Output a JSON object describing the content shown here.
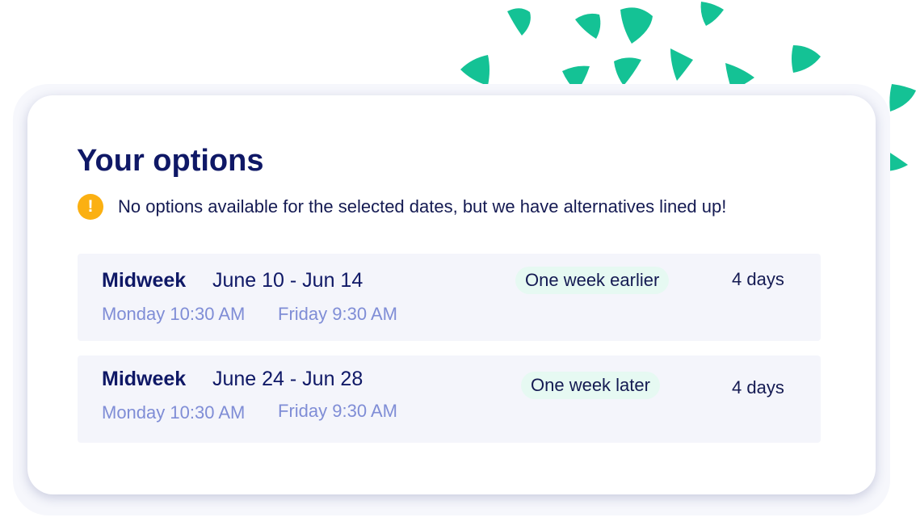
{
  "title": "Your options",
  "notice": {
    "icon": "warning-icon",
    "icon_glyph": "!",
    "text": "No options available for the selected dates, but we have alternatives lined up!"
  },
  "options": [
    {
      "kind": "Midweek",
      "range": "June 10 - Jun 14",
      "check_in": "Monday 10:30 AM",
      "check_out": "Friday 9:30 AM",
      "tag": "One week earlier",
      "duration": "4 days"
    },
    {
      "kind": "Midweek",
      "range": "June 24 - Jun 28",
      "check_in": "Monday 10:30 AM",
      "check_out": "Friday 9:30 AM",
      "tag": "One week later",
      "duration": "4 days"
    }
  ],
  "colors": {
    "heading": "#0f1866",
    "text": "#141a52",
    "muted_time": "#7f8dd6",
    "warning": "#fbb012",
    "tag_background": "#e6f9f2",
    "row_background": "#f4f5fb",
    "confetti": "#14c295"
  }
}
